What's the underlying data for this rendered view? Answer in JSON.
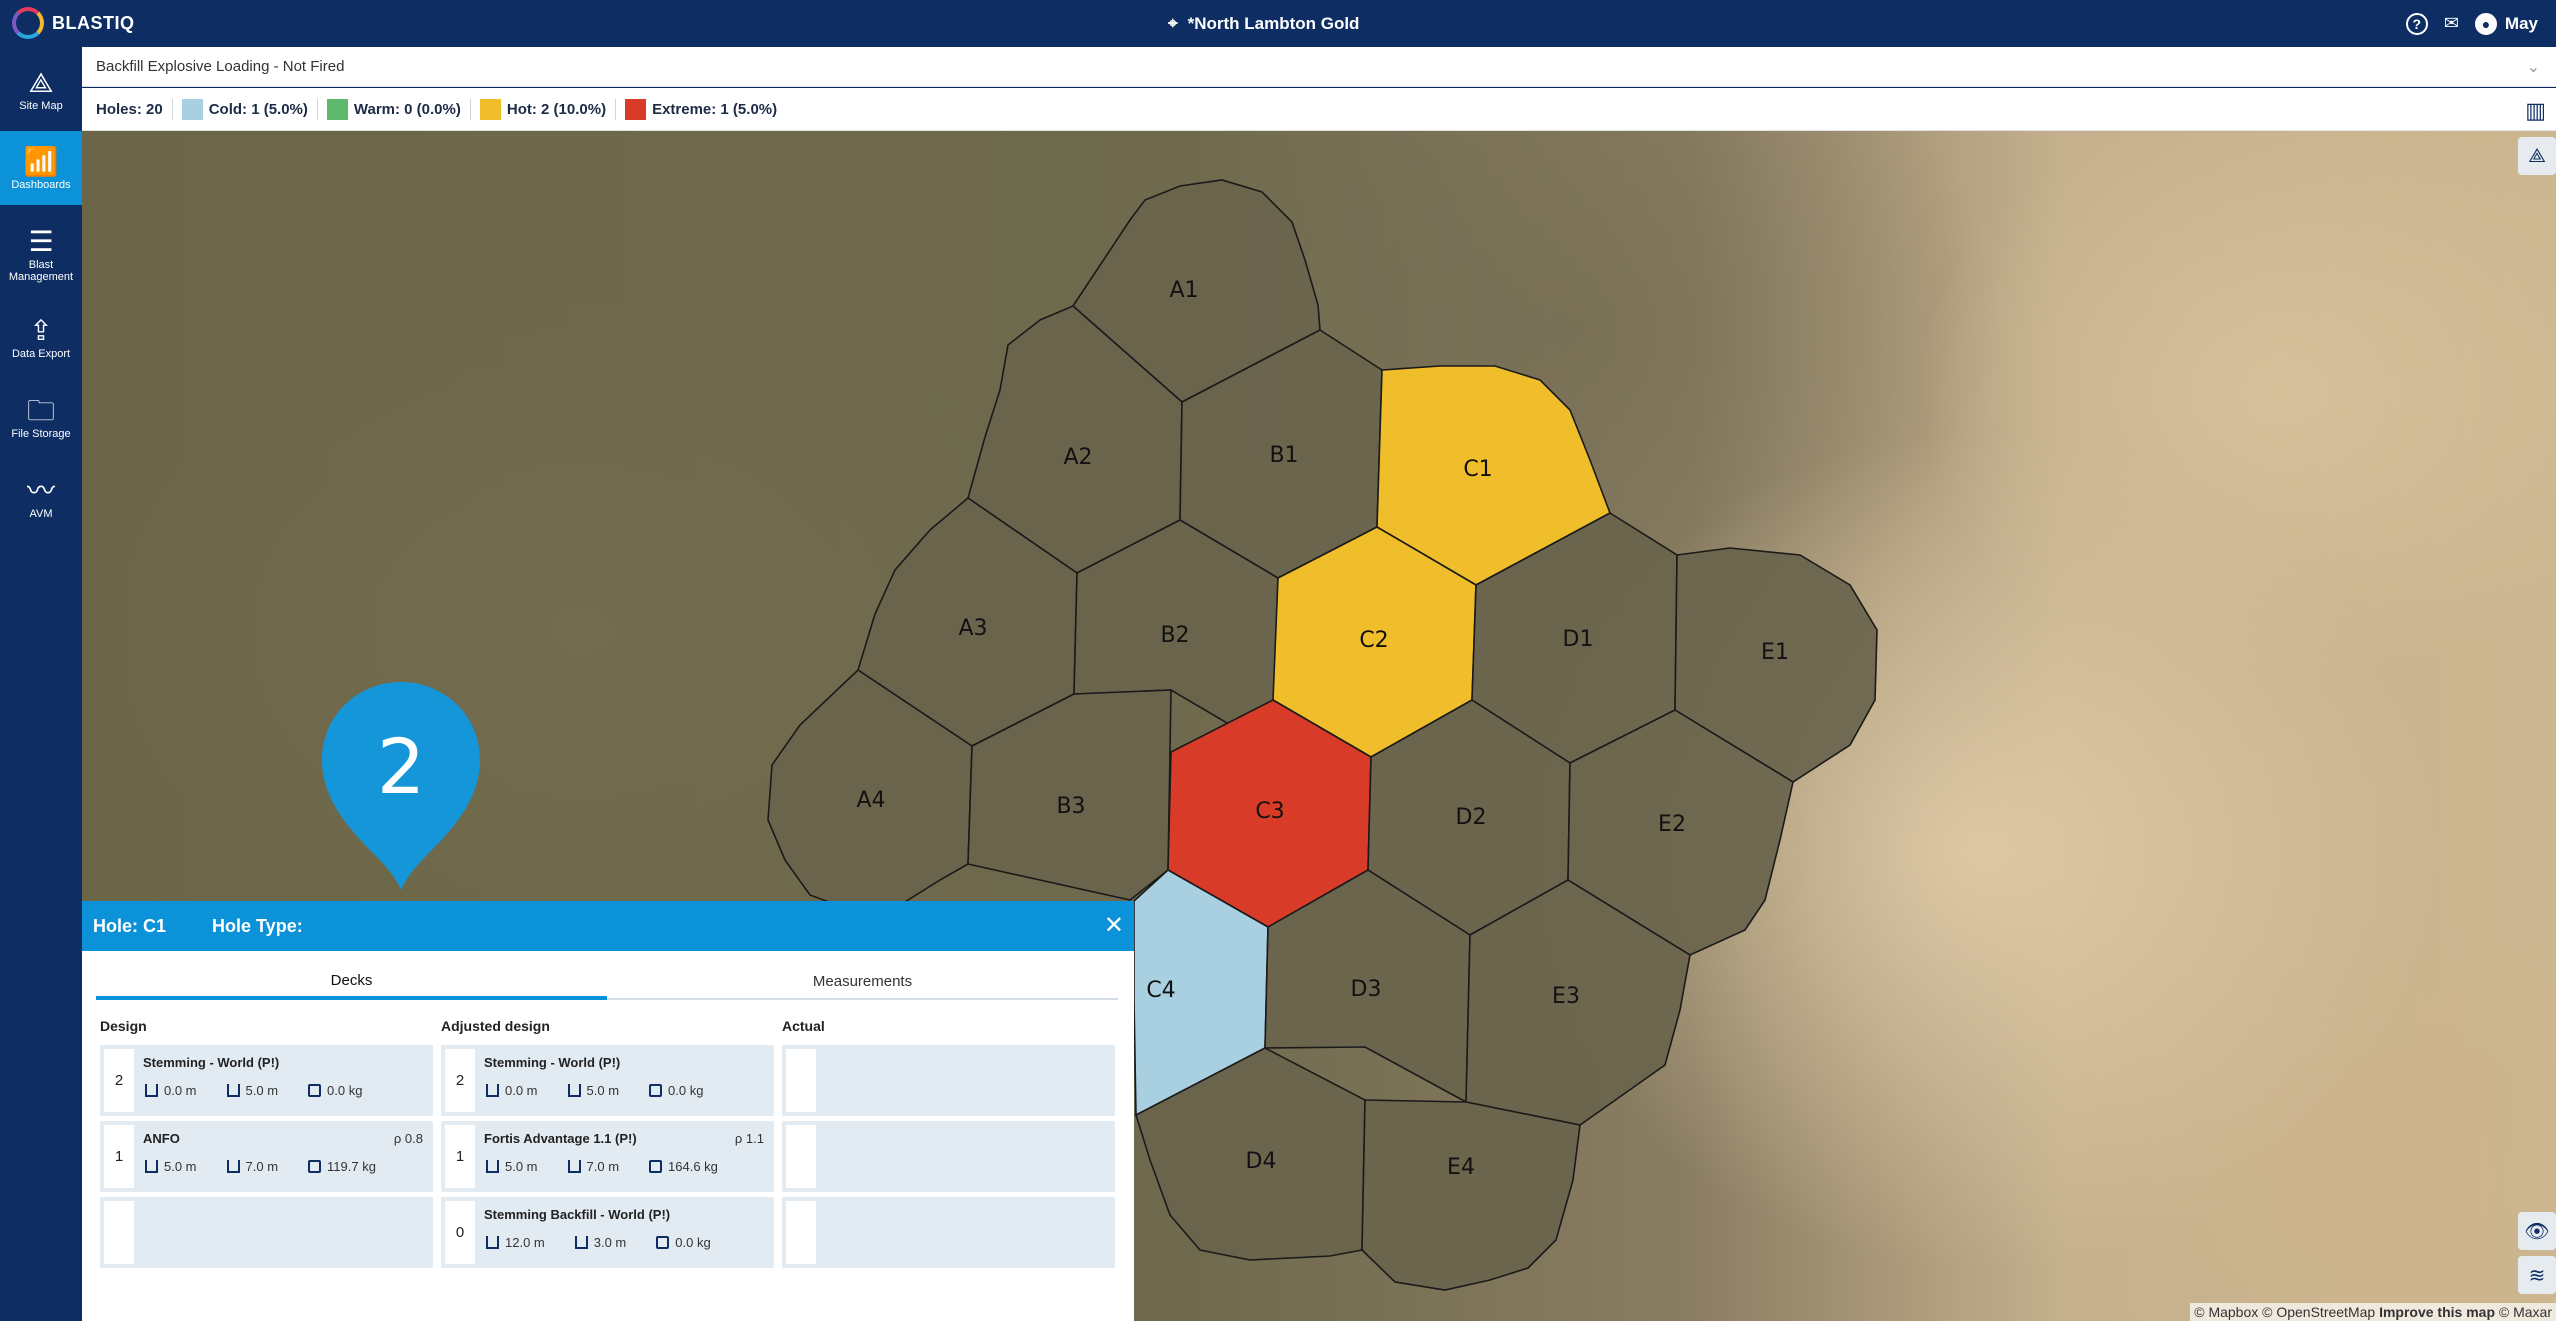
{
  "app": {
    "logo_text": "BLASTIQ",
    "site_title": "*North Lambton Gold",
    "user_name": "May"
  },
  "sidebar": {
    "items": [
      {
        "label": "Site Map",
        "icon": "site-map-icon",
        "active": false
      },
      {
        "label": "Dashboards",
        "icon": "dashboards-icon",
        "active": true
      },
      {
        "label": "Blast Management",
        "icon": "blast-management-icon",
        "active": false
      },
      {
        "label": "Data Export",
        "icon": "data-export-icon",
        "active": false
      },
      {
        "label": "File Storage",
        "icon": "file-storage-icon",
        "active": false
      },
      {
        "label": "AVM",
        "icon": "avm-icon",
        "active": false
      }
    ]
  },
  "dashboard_select": {
    "value": "Backfill Explosive Loading - Not Fired"
  },
  "legend": {
    "holes": "Holes: 20",
    "items": [
      {
        "label": "Cold: 1 (5.0%)",
        "color": "#a8d0e1"
      },
      {
        "label": "Warm: 0 (0.0%)",
        "color": "#5fb96c"
      },
      {
        "label": "Hot: 2 (10.0%)",
        "color": "#f0bd2b"
      },
      {
        "label": "Extreme: 1 (5.0%)",
        "color": "#d83b28"
      }
    ]
  },
  "holes": [
    {
      "id": "A1",
      "status": "none"
    },
    {
      "id": "A2",
      "status": "none"
    },
    {
      "id": "A3",
      "status": "none"
    },
    {
      "id": "A4",
      "status": "none"
    },
    {
      "id": "B1",
      "status": "none"
    },
    {
      "id": "B2",
      "status": "none"
    },
    {
      "id": "B3",
      "status": "none"
    },
    {
      "id": "C1",
      "status": "hot"
    },
    {
      "id": "C2",
      "status": "hot"
    },
    {
      "id": "C3",
      "status": "extreme"
    },
    {
      "id": "C4",
      "status": "cold"
    },
    {
      "id": "D1",
      "status": "none"
    },
    {
      "id": "D2",
      "status": "none"
    },
    {
      "id": "D3",
      "status": "none"
    },
    {
      "id": "D4",
      "status": "none"
    },
    {
      "id": "E1",
      "status": "none"
    },
    {
      "id": "E2",
      "status": "none"
    },
    {
      "id": "E3",
      "status": "none"
    },
    {
      "id": "E4",
      "status": "none"
    }
  ],
  "marker": {
    "label": "2"
  },
  "attribution": {
    "mapbox": "© Mapbox",
    "osm": "© OpenStreetMap",
    "improve": "Improve this map",
    "maxar": "© Maxar"
  },
  "panel": {
    "hole_label": "Hole: C1",
    "hole_type_label": "Hole Type:",
    "tabs": [
      "Decks",
      "Measurements"
    ],
    "columns": {
      "design": "Design",
      "adjusted": "Adjusted design",
      "actual": "Actual"
    },
    "design": [
      {
        "num": "2",
        "name": "Stemming - World (P!)",
        "rho": "",
        "depth": "0.0 m",
        "length": "5.0 m",
        "mass": "0.0 kg"
      },
      {
        "num": "1",
        "name": "ANFO",
        "rho": "ρ 0.8",
        "depth": "5.0 m",
        "length": "7.0 m",
        "mass": "119.7 kg"
      }
    ],
    "adjusted": [
      {
        "num": "2",
        "name": "Stemming - World (P!)",
        "rho": "",
        "depth": "0.0 m",
        "length": "5.0 m",
        "mass": "0.0 kg"
      },
      {
        "num": "1",
        "name": "Fortis Advantage 1.1 (P!)",
        "rho": "ρ 1.1",
        "depth": "5.0 m",
        "length": "7.0 m",
        "mass": "164.6 kg"
      },
      {
        "num": "0",
        "name": "Stemming Backfill - World (P!)",
        "rho": "",
        "depth": "12.0 m",
        "length": "3.0 m",
        "mass": "0.0 kg"
      }
    ]
  }
}
